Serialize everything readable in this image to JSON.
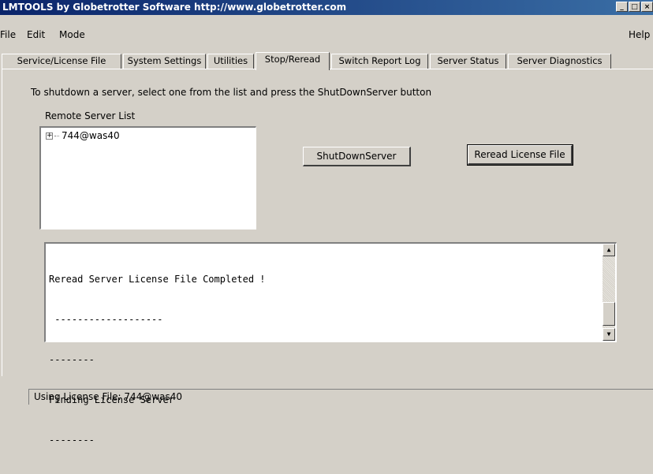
{
  "window": {
    "title": "LMTOOLS by Globetrotter Software http://www.globetrotter.com",
    "controls": {
      "minimize": "_",
      "maximize": "□",
      "close": "×"
    }
  },
  "menu": {
    "file": "File",
    "edit": "Edit",
    "mode": "Mode",
    "help": "Help"
  },
  "tabs": [
    {
      "label": "Service/License File"
    },
    {
      "label": "System Settings"
    },
    {
      "label": "Utilities"
    },
    {
      "label": "Stop/Reread"
    },
    {
      "label": "Switch Report Log"
    },
    {
      "label": "Server Status"
    },
    {
      "label": "Server Diagnostics"
    }
  ],
  "active_tab": "Stop/Reread",
  "panel": {
    "instruction": "To shutdown a server, select one from the list and press the ShutDownServer button",
    "remote_server_list_label": "Remote Server List",
    "servers": [
      {
        "name": "744@was40",
        "expander": "+"
      }
    ],
    "shutdown_button": "ShutDownServer",
    "reread_button": "Reread License File",
    "output_lines": [
      "Reread Server License File Completed !",
      " -------------------",
      "--------",
      "Finding License Server",
      "--------"
    ]
  },
  "status": {
    "text": "Using License File:  744@was40"
  }
}
